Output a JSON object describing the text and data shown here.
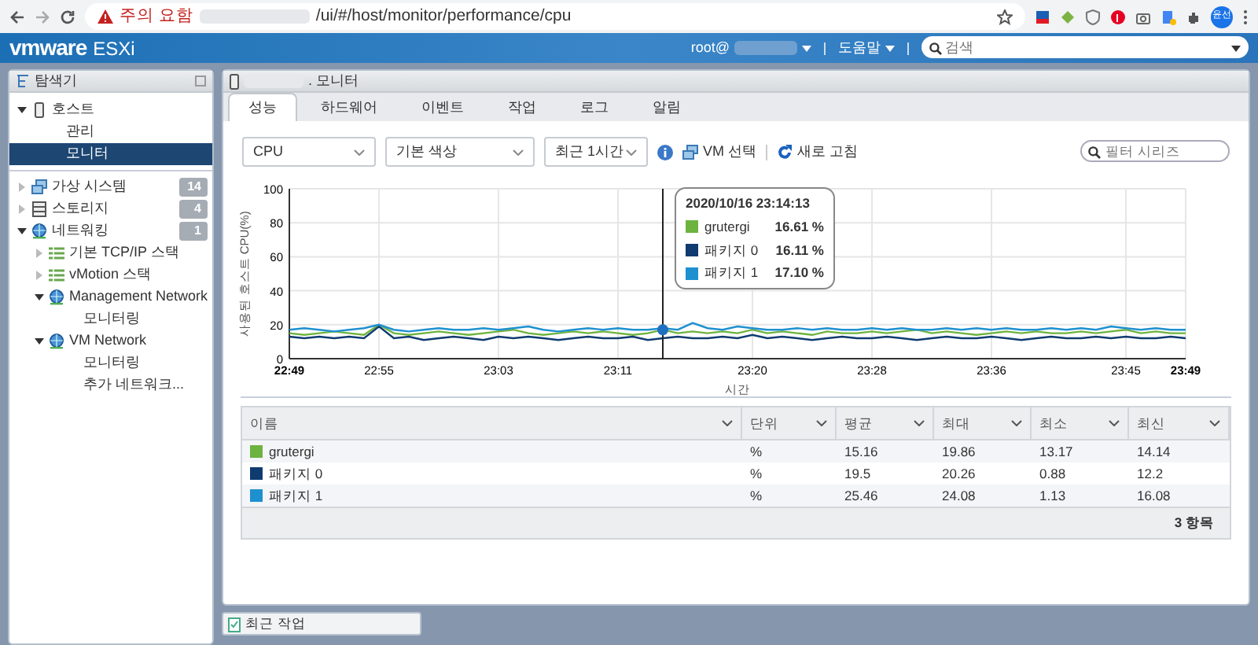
{
  "browser": {
    "warning": "주의 요함",
    "url": "/ui/#/host/monitor/performance/cpu",
    "avatar": "윤선"
  },
  "header": {
    "brand": "vmware",
    "product": "ESXi",
    "user": "root@",
    "help": "도움말",
    "search": {
      "placeholder": "검색"
    }
  },
  "navigator": {
    "title": "탐색기",
    "items": [
      {
        "label": "호스트",
        "kind": "host",
        "expanded": true,
        "selected": false,
        "children": [
          {
            "label": "관리",
            "selected": false
          },
          {
            "label": "모니터",
            "selected": true
          }
        ]
      },
      {
        "label": "가상 시스템",
        "kind": "vm",
        "expanded": false,
        "selected": false,
        "count": "14"
      },
      {
        "label": "스토리지",
        "kind": "storage",
        "expanded": false,
        "selected": false,
        "count": "4"
      },
      {
        "label": "네트워킹",
        "kind": "network",
        "expanded": true,
        "selected": false,
        "count": "1",
        "children": [
          {
            "label": "기본 TCP/IP 스택",
            "kind": "stack",
            "expanded": false,
            "selected": false
          },
          {
            "label": "vMotion 스택",
            "kind": "stack",
            "expanded": false,
            "selected": false
          },
          {
            "label": "Management Network",
            "kind": "network",
            "expanded": true,
            "selected": false,
            "children": [
              {
                "label": "모니터링",
                "selected": false
              }
            ]
          },
          {
            "label": "VM Network",
            "kind": "network",
            "expanded": true,
            "selected": false,
            "children": [
              {
                "label": "모니터링",
                "selected": false
              },
              {
                "label": "추가 네트워크...",
                "selected": false
              }
            ]
          }
        ]
      }
    ]
  },
  "main": {
    "title": ". 모니터",
    "tabs": [
      {
        "label": "성능",
        "selected": true
      },
      {
        "label": "하드웨어",
        "selected": false
      },
      {
        "label": "이벤트",
        "selected": false
      },
      {
        "label": "작업",
        "selected": false
      },
      {
        "label": "로그",
        "selected": false
      },
      {
        "label": "알림",
        "selected": false
      }
    ],
    "toolbar": {
      "selects": [
        "CPU",
        "기본 색상",
        "최근 1시간"
      ],
      "vm_select": "VM 선택",
      "refresh": "새로 고침",
      "filter": {
        "placeholder": "필터 시리즈"
      }
    },
    "chart_data": {
      "type": "line",
      "xlabel": "시간",
      "ylabel": "사용된 호스트 CPU(%)",
      "categories": [
        "22:49",
        null,
        null,
        null,
        null,
        null,
        "22:55",
        null,
        null,
        null,
        null,
        null,
        null,
        null,
        "23:03",
        null,
        null,
        null,
        null,
        null,
        null,
        null,
        "23:11",
        null,
        null,
        null,
        null,
        null,
        null,
        null,
        null,
        "23:20",
        null,
        null,
        null,
        null,
        null,
        null,
        null,
        "23:28",
        null,
        null,
        null,
        null,
        null,
        null,
        null,
        "23:36",
        null,
        null,
        null,
        null,
        null,
        null,
        null,
        null,
        "23:45",
        null,
        null,
        null,
        "23:49"
      ],
      "series": [
        {
          "name": "grutergi",
          "color": "#6db33f",
          "values": [
            15,
            14,
            15,
            16,
            15,
            14,
            20,
            15,
            14,
            15,
            16,
            15,
            14,
            15,
            16,
            17,
            15,
            14,
            15,
            16,
            15,
            16,
            15,
            14,
            15,
            17,
            15,
            16,
            15,
            16,
            15,
            17,
            15,
            16,
            15,
            14,
            16,
            15,
            15,
            16,
            15,
            16,
            17,
            15,
            16,
            15,
            14,
            15,
            16,
            15,
            16,
            15,
            15,
            16,
            15,
            16,
            17,
            15,
            16,
            15,
            15
          ]
        },
        {
          "name": "패키지 0",
          "color": "#0f3b70",
          "values": [
            13,
            12,
            13,
            12,
            13,
            12,
            19,
            12,
            13,
            11,
            12,
            13,
            12,
            11,
            13,
            12,
            13,
            12,
            11,
            12,
            13,
            12,
            12,
            13,
            11,
            12,
            13,
            12,
            12,
            13,
            12,
            14,
            12,
            13,
            12,
            11,
            12,
            13,
            12,
            12,
            13,
            12,
            11,
            12,
            13,
            12,
            12,
            13,
            12,
            11,
            12,
            13,
            12,
            12,
            13,
            12,
            13,
            12,
            12,
            13,
            12
          ]
        },
        {
          "name": "패키지 1",
          "color": "#1e90d0",
          "values": [
            17,
            18,
            17,
            16,
            17,
            18,
            20,
            17,
            16,
            17,
            18,
            17,
            17,
            18,
            17,
            18,
            19,
            17,
            16,
            17,
            18,
            17,
            18,
            17,
            17,
            18,
            17,
            21,
            18,
            17,
            19,
            18,
            17,
            17,
            18,
            17,
            18,
            17,
            17,
            18,
            17,
            18,
            17,
            17,
            18,
            17,
            18,
            17,
            18,
            17,
            17,
            18,
            17,
            18,
            17,
            19,
            18,
            17,
            18,
            17,
            17
          ]
        }
      ],
      "ylim": [
        0,
        100
      ],
      "yticks": [
        0,
        20,
        40,
        60,
        80,
        100
      ],
      "grid": true,
      "legend": "top"
    },
    "tooltip": {
      "title": "2020/10/16 23:14:13",
      "values": [
        "16.61 %",
        "16.11 %",
        "17.10 %"
      ]
    },
    "table": {
      "columns": [
        "이름",
        "단위",
        "평균",
        "최대",
        "최소",
        "최신"
      ],
      "rows": [
        {
          "color": "#6db33f",
          "cells": [
            "grutergi",
            "%",
            "15.16",
            "19.86",
            "13.17",
            "14.14"
          ]
        },
        {
          "color": "#0f3b70",
          "cells": [
            "패키지 0",
            "%",
            "19.5",
            "20.26",
            "0.88",
            "12.2"
          ]
        },
        {
          "color": "#1e90d0",
          "cells": [
            "패키지 1",
            "%",
            "25.46",
            "24.08",
            "1.13",
            "16.08"
          ]
        }
      ],
      "footer": "3 항목"
    }
  },
  "recent_tasks": "최근 작업"
}
